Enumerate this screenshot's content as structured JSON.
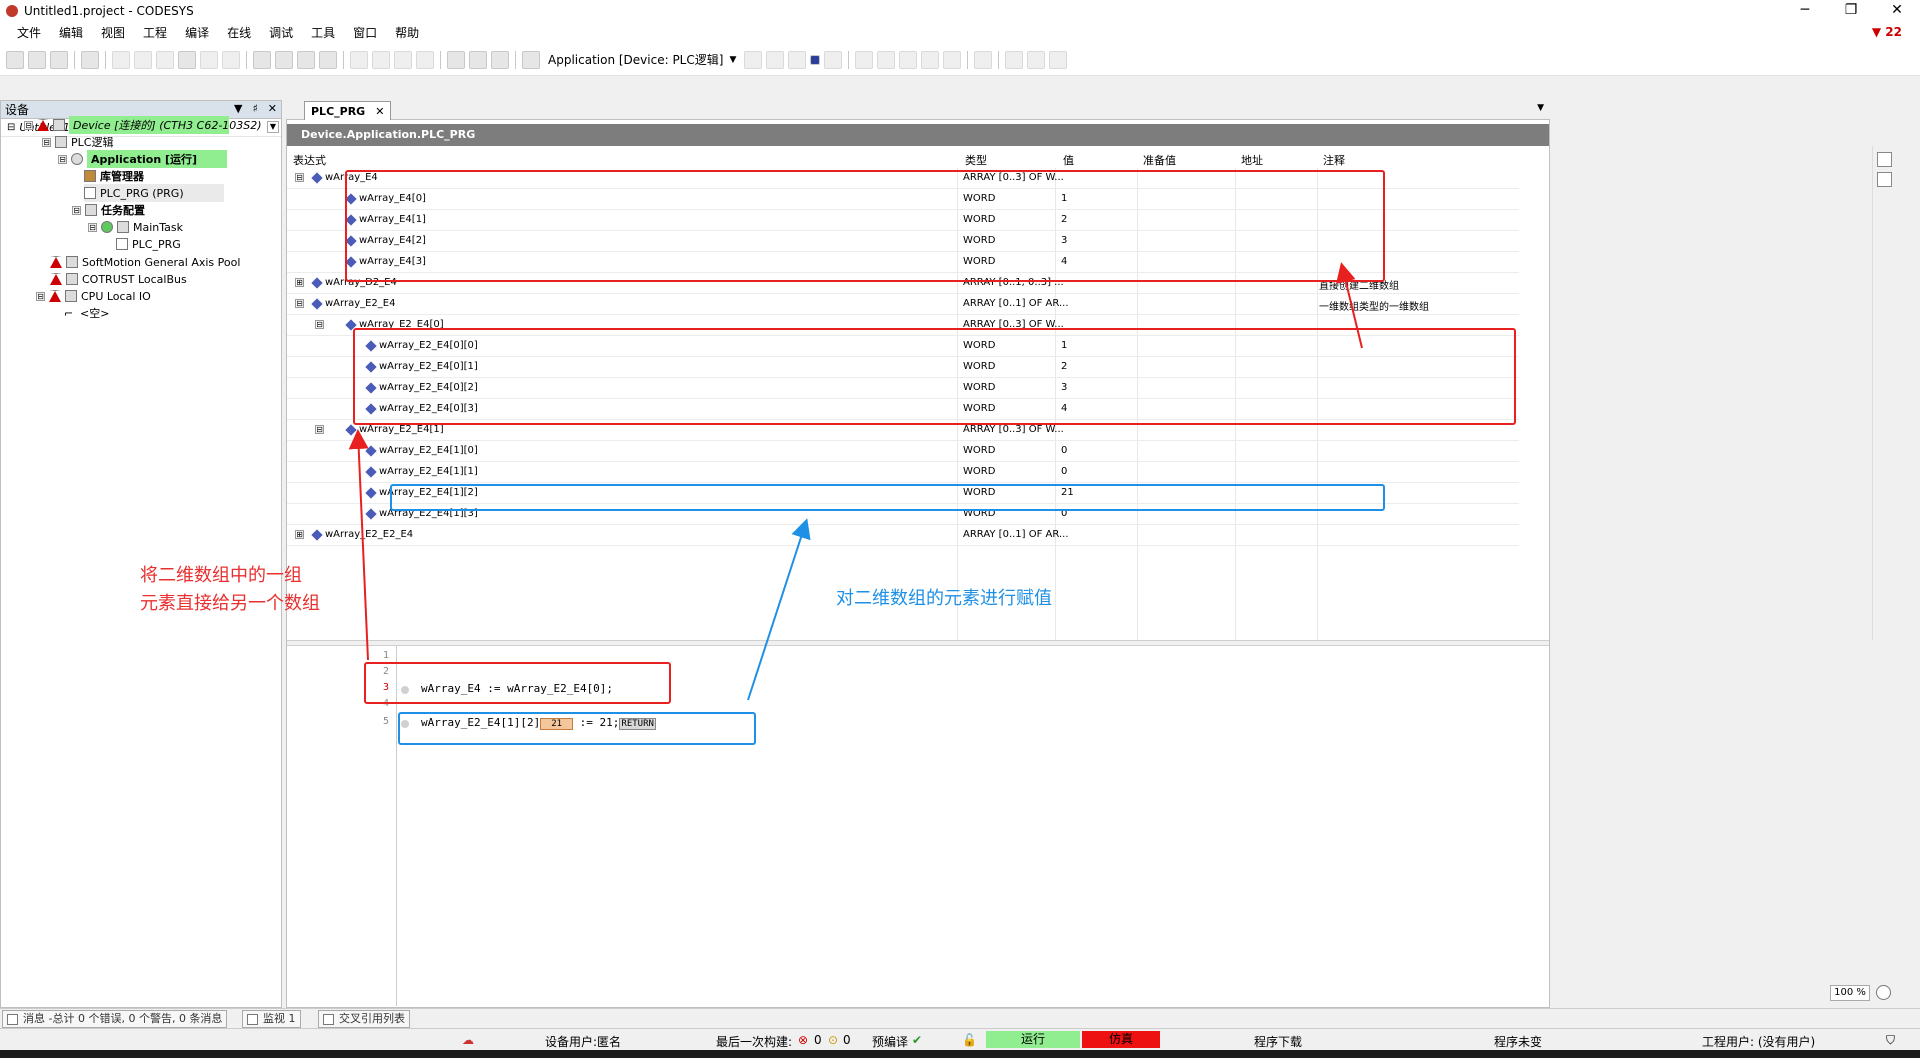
{
  "window": {
    "title": "Untitled1.project - CODESYS",
    "controls": [
      "─",
      "❐",
      "✕"
    ]
  },
  "menu": [
    "文件",
    "编辑",
    "视图",
    "工程",
    "编译",
    "在线",
    "调试",
    "工具",
    "窗口",
    "帮助"
  ],
  "error_badge": "22",
  "toolbar": {
    "application_selector": "Application [Device: PLC逻辑]"
  },
  "device_panel": {
    "title": "设备",
    "controls": [
      "▼",
      "♯",
      "✕"
    ],
    "tree_header": "Untitled1",
    "nodes": [
      {
        "label": "Untitled1",
        "expander": "⊟"
      },
      {
        "label": "Device [连接的] (CTH3 C62-103S2)",
        "expander": "⊟"
      },
      {
        "label": "PLC逻辑",
        "expander": "⊟"
      },
      {
        "label": "Application [运行]",
        "expander": "⊟"
      },
      {
        "label": "库管理器",
        "expander": ""
      },
      {
        "label": "PLC_PRG (PRG)",
        "expander": ""
      },
      {
        "label": "任务配置",
        "expander": "⊟"
      },
      {
        "label": "MainTask",
        "expander": "⊟"
      },
      {
        "label": "PLC_PRG",
        "expander": ""
      },
      {
        "label": "SoftMotion General Axis Pool",
        "expander": ""
      },
      {
        "label": "COTRUST LocalBus",
        "expander": ""
      },
      {
        "label": "CPU Local IO",
        "expander": "⊟"
      },
      {
        "label": "<空>",
        "expander": ""
      }
    ]
  },
  "editor": {
    "tab_label": "PLC_PRG",
    "tab_close": "✕",
    "path": "Device.Application.PLC_PRG",
    "columns": [
      "表达式",
      "类型",
      "值",
      "准备值",
      "地址",
      "注释"
    ],
    "rows": [
      {
        "expr": "wArray_E4",
        "type": "ARRAY [0..3] OF W...",
        "value": "",
        "comment": "",
        "pm": "⊟"
      },
      {
        "expr": "wArray_E4[0]",
        "type": "WORD",
        "value": "1",
        "comment": "",
        "pm": ""
      },
      {
        "expr": "wArray_E4[1]",
        "type": "WORD",
        "value": "2",
        "comment": "",
        "pm": ""
      },
      {
        "expr": "wArray_E4[2]",
        "type": "WORD",
        "value": "3",
        "comment": "",
        "pm": ""
      },
      {
        "expr": "wArray_E4[3]",
        "type": "WORD",
        "value": "4",
        "comment": "",
        "pm": ""
      },
      {
        "expr": "wArray_D2_E4",
        "type": "ARRAY [0..1, 0..3] ...",
        "value": "",
        "comment": "直接创建二维数组",
        "pm": "⊞"
      },
      {
        "expr": "wArray_E2_E4",
        "type": "ARRAY [0..1] OF AR...",
        "value": "",
        "comment": "一维数组类型的一维数组",
        "pm": "⊟"
      },
      {
        "expr": "wArray_E2_E4[0]",
        "type": "ARRAY [0..3] OF W...",
        "value": "",
        "comment": "",
        "pm": "⊟"
      },
      {
        "expr": "wArray_E2_E4[0][0]",
        "type": "WORD",
        "value": "1",
        "comment": "",
        "pm": ""
      },
      {
        "expr": "wArray_E2_E4[0][1]",
        "type": "WORD",
        "value": "2",
        "comment": "",
        "pm": ""
      },
      {
        "expr": "wArray_E2_E4[0][2]",
        "type": "WORD",
        "value": "3",
        "comment": "",
        "pm": ""
      },
      {
        "expr": "wArray_E2_E4[0][3]",
        "type": "WORD",
        "value": "4",
        "comment": "",
        "pm": ""
      },
      {
        "expr": "wArray_E2_E4[1]",
        "type": "ARRAY [0..3] OF W...",
        "value": "",
        "comment": "",
        "pm": "⊟"
      },
      {
        "expr": "wArray_E2_E4[1][0]",
        "type": "WORD",
        "value": "0",
        "comment": "",
        "pm": ""
      },
      {
        "expr": "wArray_E2_E4[1][1]",
        "type": "WORD",
        "value": "0",
        "comment": "",
        "pm": ""
      },
      {
        "expr": "wArray_E2_E4[1][2]",
        "type": "WORD",
        "value": "21",
        "comment": "",
        "pm": ""
      },
      {
        "expr": "wArray_E2_E4[1][3]",
        "type": "WORD",
        "value": "0",
        "comment": "",
        "pm": ""
      },
      {
        "expr": "wArray_E2_E2_E4",
        "type": "ARRAY [0..1] OF AR...",
        "value": "",
        "comment": "",
        "pm": "⊞"
      }
    ],
    "code": {
      "line_numbers": [
        "1",
        "2",
        "3",
        "4",
        "5"
      ],
      "line3": "wArray_E4 := wArray_E2_E4[0];",
      "line5_prefix": "wArray_E2_E4[1][2]",
      "line5_inline_value": "21",
      "line5_suffix": " := 21;",
      "line5_return": "RETURN"
    },
    "zoom": "100 %"
  },
  "annotations": {
    "red_text_line1": "将二维数组中的一组",
    "red_text_line2": "元素直接给另一个数组",
    "blue_text": "对二维数组的元素进行赋值",
    "red_color": "#e82020",
    "blue_color": "#1e90e6"
  },
  "bottom_tabs": [
    "消息 -总计 0 个错误, 0 个警告, 0 条消息",
    "监视 1",
    "交叉引用列表"
  ],
  "status_bar": {
    "device_user": "设备用户:匿名",
    "last_build": "最后一次构建:",
    "errors": "0",
    "warnings": "0",
    "precompile": "预编译",
    "run": "运行",
    "simulation": "仿真",
    "download": "程序下载",
    "program_state": "程序未变",
    "project_user": "工程用户: (没有用户)",
    "run_color": "#90ee90",
    "sim_color": "#ee1111"
  }
}
